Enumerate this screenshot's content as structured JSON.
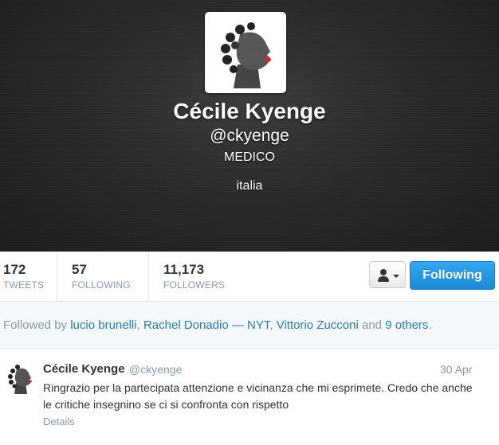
{
  "profile": {
    "name": "Cécile Kyenge",
    "handle": "@ckyenge",
    "bio": "MEDICO",
    "location": "italia"
  },
  "stats": [
    {
      "value": "172",
      "label": "TWEETS"
    },
    {
      "value": "57",
      "label": "FOLLOWING"
    },
    {
      "value": "11,173",
      "label": "FOLLOWERS"
    }
  ],
  "actions": {
    "follow_label": "Following"
  },
  "followed_by": {
    "prefix": "Followed by",
    "users": [
      "lucio brunelli",
      "Rachel Donadio — NYT",
      "Vittorio Zucconi"
    ],
    "sep": ", ",
    "and": " and ",
    "others": "9 others",
    "end": "."
  },
  "tweet": {
    "name": "Cécile Kyenge",
    "handle": "@ckyenge",
    "time": "30 Apr",
    "text": "Ringrazio per la partecipata attenzione e vicinanza che mi esprimete. Credo che anche le critiche insegnino se ci si confronta con rispetto",
    "details": "Details"
  },
  "colors": {
    "link": "#2b7bb9",
    "follow_button": "#1b8ad8",
    "muted": "#8899a6"
  },
  "icons": {
    "user_menu": "person-icon",
    "dropdown": "caret-down-icon"
  }
}
